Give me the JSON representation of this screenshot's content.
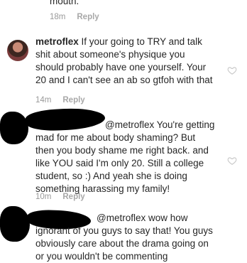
{
  "comments": [
    {
      "text": "mouth.",
      "time": "18m",
      "reply_label": "Reply"
    },
    {
      "username": "metroflex",
      "text": "If your going to TRY and talk shit about someone's physique you should probably have one yourself. Your 20 and I can't see an ab so gtfoh with that",
      "time": "14m",
      "reply_label": "Reply"
    },
    {
      "mention": "@metroflex",
      "text": "You're getting mad for me about body shaming? But then you body shame me right back. and like YOU said I'm only 20. Still a college student, so :) And yeah she is doing something harassing my family!",
      "time": "10m",
      "reply_label": "Reply"
    },
    {
      "mention": "@metroflex",
      "text": "wow how ignorant of you guys to say that! You guys obviously care about the drama going on or you wouldn't be commenting"
    }
  ],
  "icons": {
    "like": "heart-outline-icon",
    "avatar": "user-avatar"
  },
  "colors": {
    "text": "#262626",
    "meta": "#999999",
    "icon": "#c7c7c7",
    "redaction": "#000000"
  }
}
